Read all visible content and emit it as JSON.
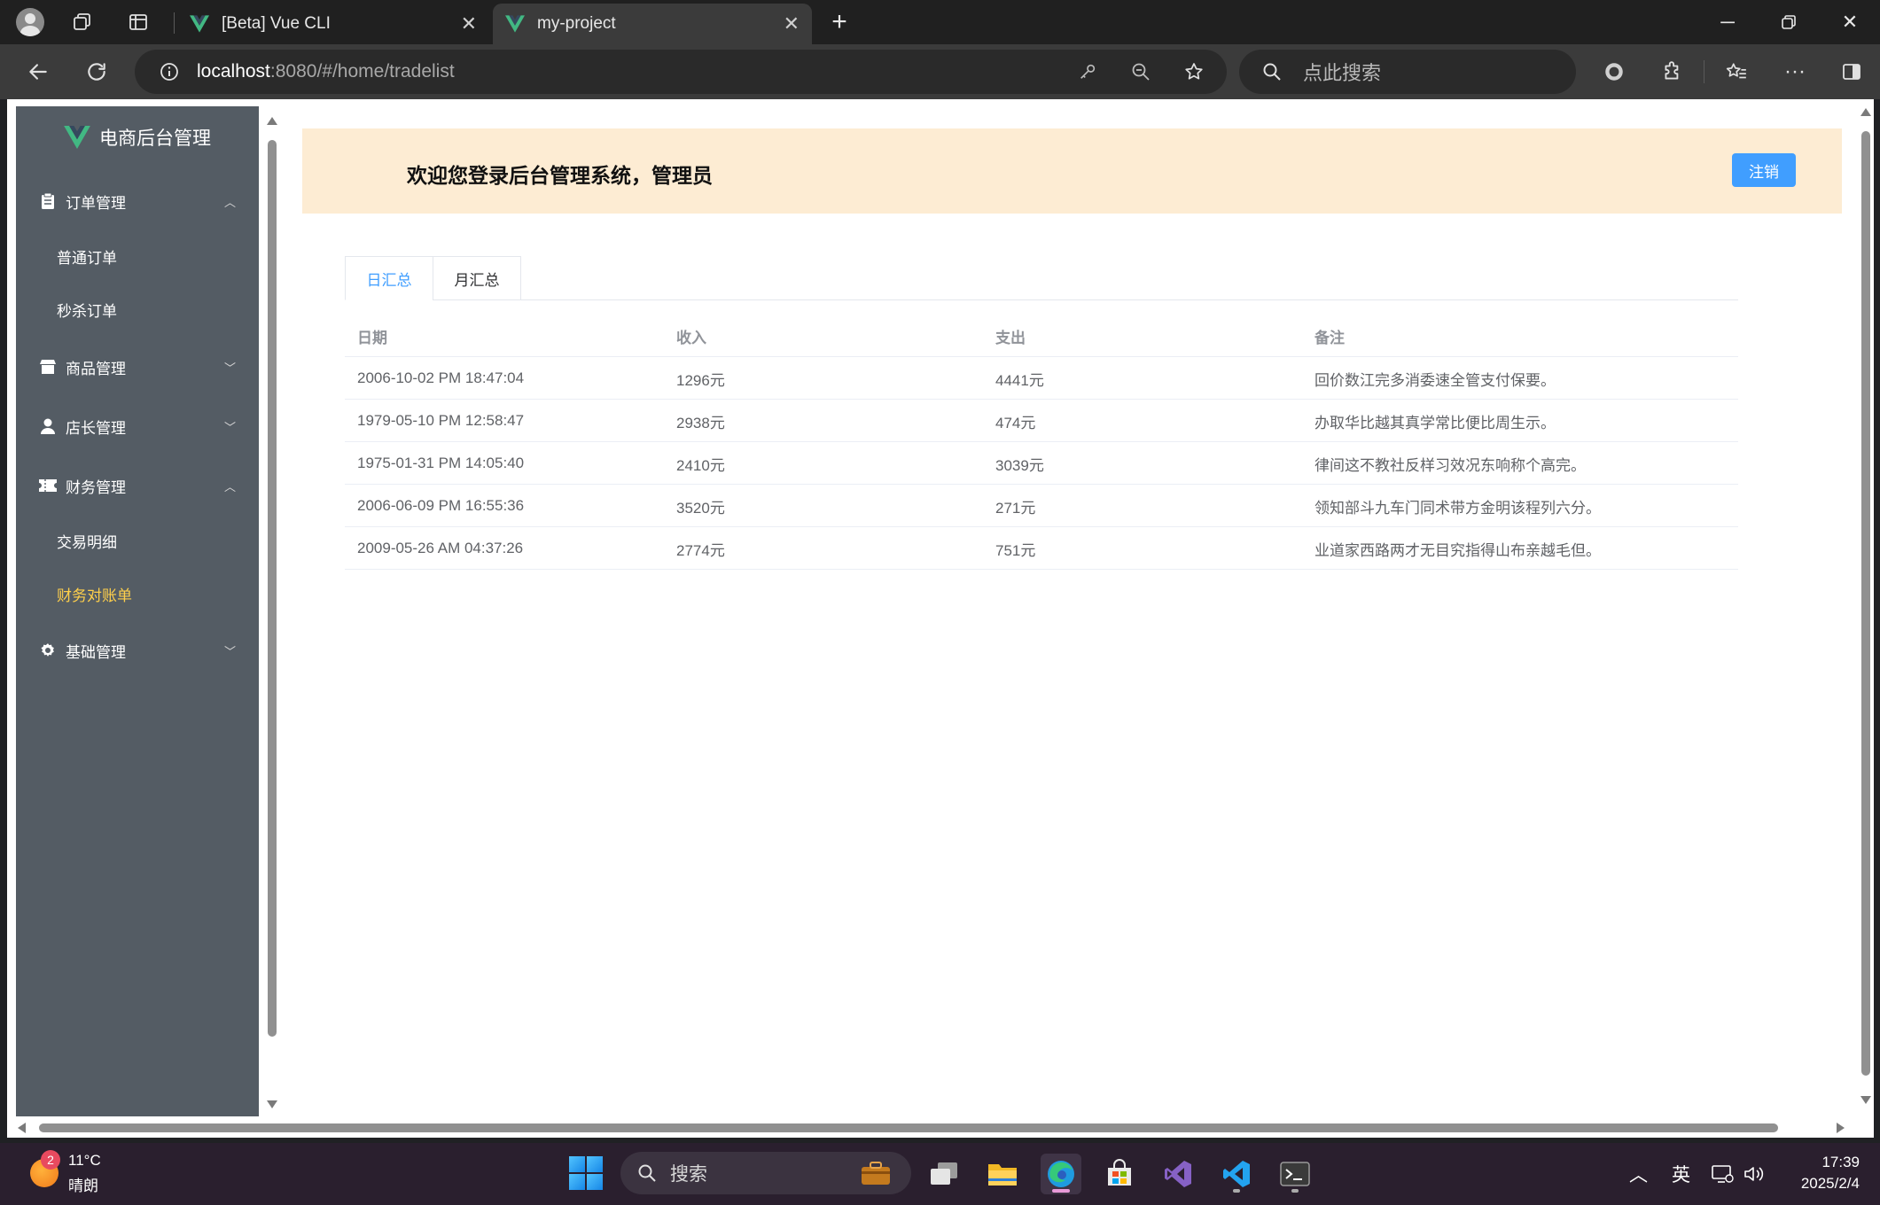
{
  "browser": {
    "tabs": [
      {
        "title": "[Beta] Vue CLI",
        "active": false
      },
      {
        "title": "my-project",
        "active": true
      }
    ],
    "address": {
      "host": "localhost",
      "path": ":8080/#/home/tradelist"
    },
    "search_placeholder": "点此搜索",
    "icons": {
      "profile": "profile-avatar-icon",
      "workspaces": "workspaces-icon",
      "tab_actions": "tab-actions-icon",
      "new_tab": "plus-icon",
      "back": "back-arrow-icon",
      "refresh": "refresh-icon",
      "site_info": "info-icon",
      "password": "key-icon",
      "zoom": "zoom-out-icon",
      "favorite": "star-icon",
      "extensions": "puzzle-icon",
      "favorites_bar": "favorites-icon",
      "more": "more-icon",
      "sidebar": "sidebar-icon"
    }
  },
  "app": {
    "brand": "电商后台管理",
    "menu": [
      {
        "label": "订单管理",
        "icon": "clipboard-icon",
        "expanded": true,
        "children": [
          {
            "label": "普通订单",
            "active": false
          },
          {
            "label": "秒杀订单",
            "active": false
          }
        ]
      },
      {
        "label": "商品管理",
        "icon": "shop-icon",
        "expanded": false,
        "children": []
      },
      {
        "label": "店长管理",
        "icon": "user-icon",
        "expanded": false,
        "children": []
      },
      {
        "label": "财务管理",
        "icon": "ticket-icon",
        "expanded": true,
        "children": [
          {
            "label": "交易明细",
            "active": false
          },
          {
            "label": "财务对账单",
            "active": true
          }
        ]
      },
      {
        "label": "基础管理",
        "icon": "gear-icon",
        "expanded": false,
        "children": []
      }
    ],
    "header": {
      "welcome": "欢迎您登录后台管理系统，管理员",
      "logout": "注销"
    },
    "tabs": [
      {
        "label": "日汇总",
        "active": true
      },
      {
        "label": "月汇总",
        "active": false
      }
    ],
    "table": {
      "columns": [
        "日期",
        "收入",
        "支出",
        "备注"
      ],
      "rows": [
        [
          "2006-10-02 PM 18:47:04",
          "1296元",
          "4441元",
          "回价数江完多消委速全管支付保要。"
        ],
        [
          "1979-05-10 PM 12:58:47",
          "2938元",
          "474元",
          "办取华比越其真学常比便比周生示。"
        ],
        [
          "1975-01-31 PM 14:05:40",
          "2410元",
          "3039元",
          "律间这不教社反样习效况东响称个高完。"
        ],
        [
          "2006-06-09 PM 16:55:36",
          "3520元",
          "271元",
          "领知部斗九车门同术带方金明该程列六分。"
        ],
        [
          "2009-05-26 AM 04:37:26",
          "2774元",
          "751元",
          "业道家西路两才无目究指得山布亲越毛但。"
        ]
      ]
    },
    "colors": {
      "sidebar_bg": "#545c64",
      "active_menu": "#ffd04b",
      "primary": "#409eff",
      "header_bg": "#fdecd3"
    }
  },
  "taskbar": {
    "weather": {
      "badge": "2",
      "temp": "11°C",
      "condition": "晴朗"
    },
    "search": "搜索",
    "ime": "英",
    "time": "17:39",
    "date": "2025/2/4"
  }
}
